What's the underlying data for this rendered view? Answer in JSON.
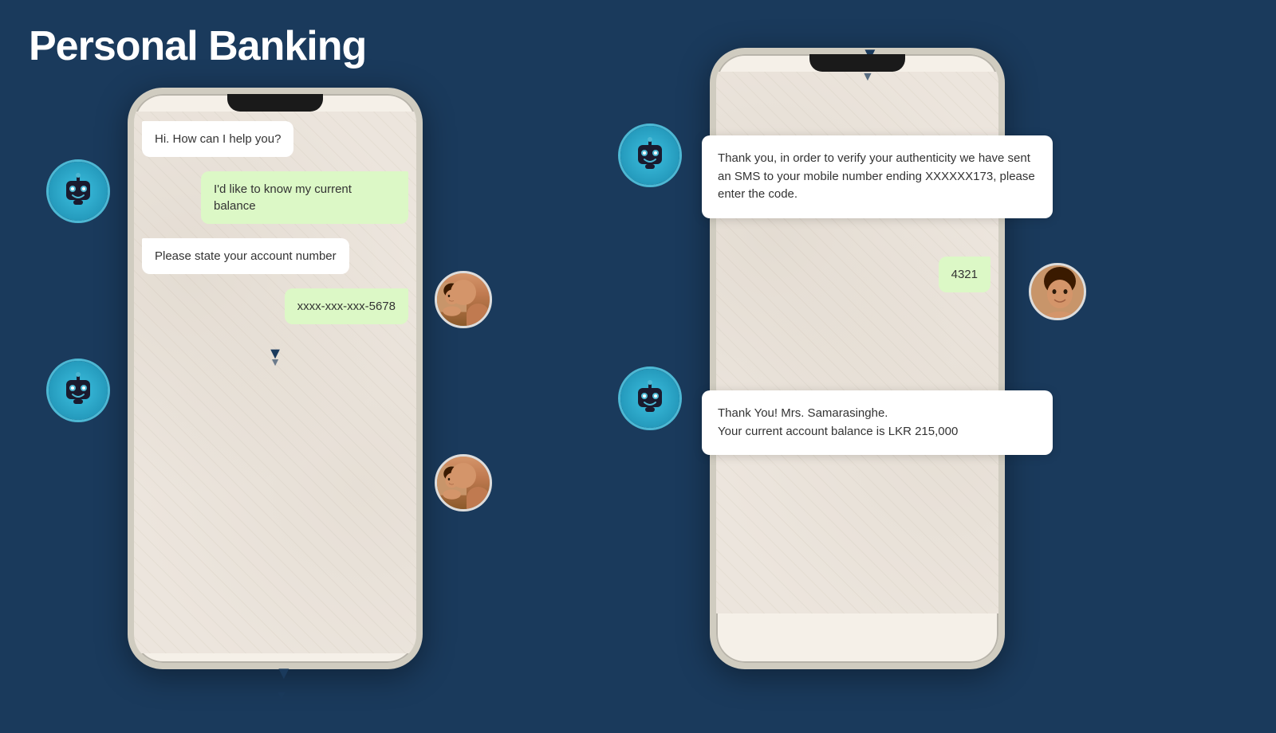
{
  "page": {
    "title": "Personal Banking",
    "background_color": "#1a3a5c"
  },
  "phone1": {
    "messages": [
      {
        "type": "bot",
        "text": "Hi. How can I help you?"
      },
      {
        "type": "user",
        "text": "I'd like to know my current balance"
      },
      {
        "type": "bot",
        "text": "Please state your account number"
      },
      {
        "type": "user",
        "text": "xxxx-xxx-xxx-5678"
      }
    ]
  },
  "phone2": {
    "messages": [
      {
        "type": "bot",
        "text": "Thank you, in order to verify your authenticity we have sent an SMS to your mobile number ending  XXXXXX173, please enter the code."
      },
      {
        "type": "user",
        "text": "4321"
      },
      {
        "type": "bot",
        "text": "Thank You! Mrs. Samarasinghe.\nYour current account balance is LKR 215,000"
      }
    ]
  },
  "scroll_arrows": {
    "char": "▼"
  }
}
